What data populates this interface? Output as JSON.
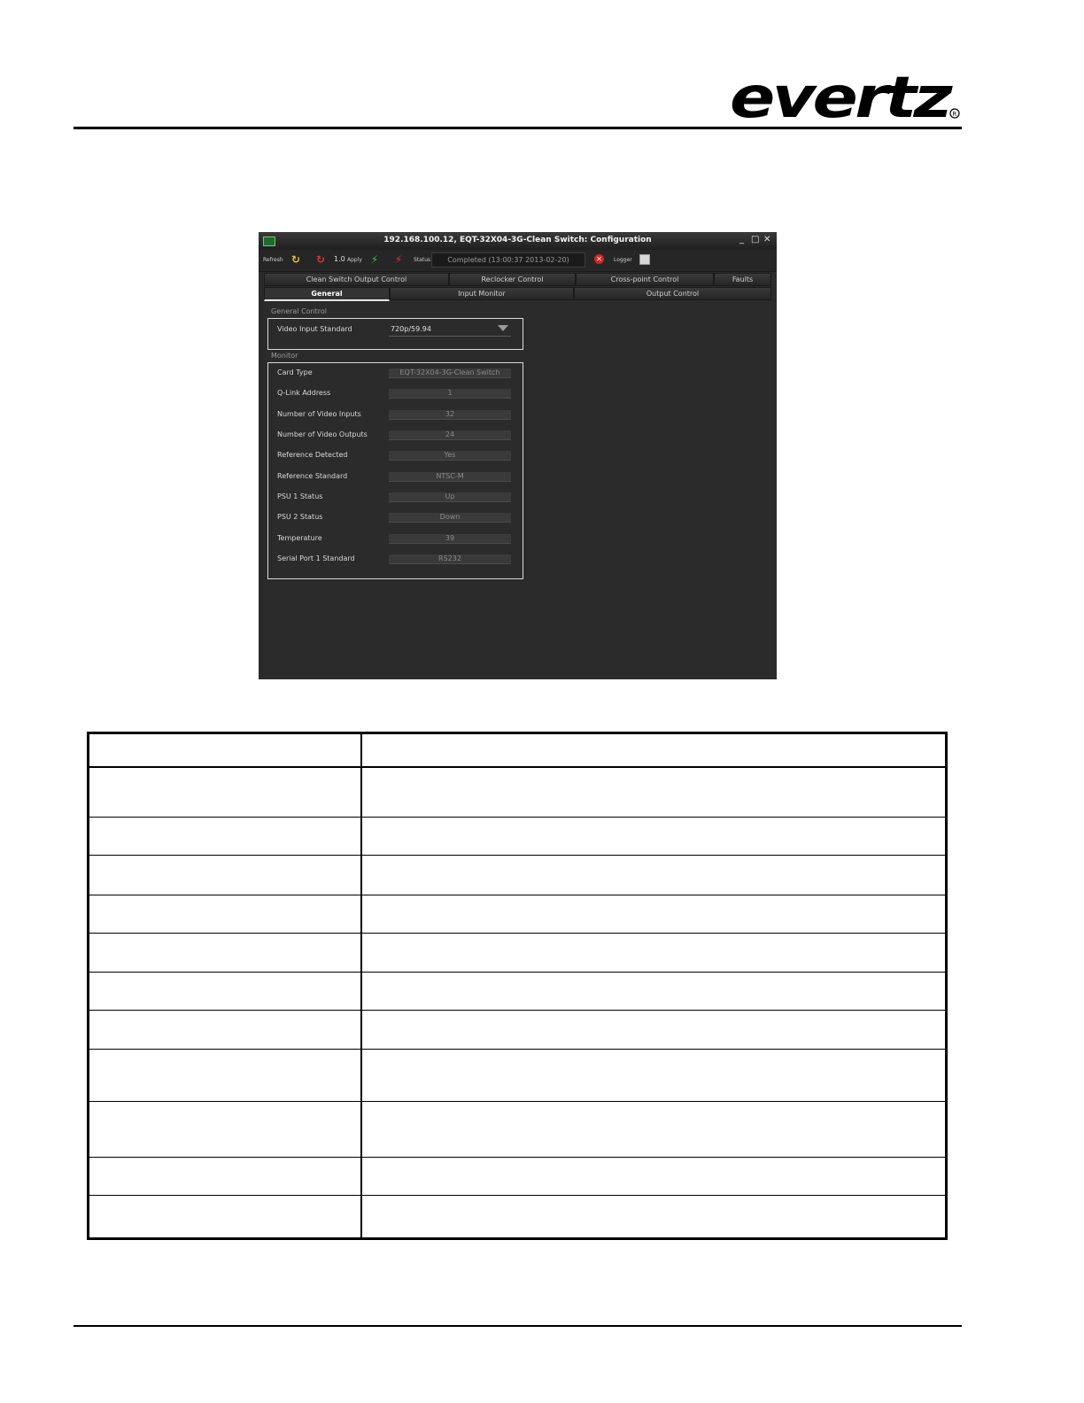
{
  "logo": {
    "text": "evertz"
  },
  "window": {
    "title": "192.168.100.12, EQT-32X04-3G-Clean Switch: Configuration",
    "controls": {
      "minimize": "_",
      "maximize": "□",
      "close": "✕"
    },
    "toolbar": {
      "refresh_label": "Refresh",
      "version": "1.0",
      "apply_label": "Apply",
      "status_label": "Status",
      "status_value": "Completed (13:00:37 2013-02-20)",
      "logger_label": "Logger"
    },
    "tabs_row1": [
      "Clean Switch Output Control",
      "Reclocker Control",
      "Cross-point Control",
      "Faults"
    ],
    "tabs_row2": [
      "General",
      "Input Monitor",
      "Output Control"
    ],
    "active_tab": "General",
    "general_control": {
      "title": "General Control",
      "video_input_standard": {
        "label": "Video Input Standard",
        "value": "720p/59.94"
      }
    },
    "monitor": {
      "title": "Monitor",
      "rows": [
        {
          "label": "Card Type",
          "value": "EQT-32X04-3G-Clean Switch"
        },
        {
          "label": "Q-Link Address",
          "value": "1"
        },
        {
          "label": "Number of Video Inputs",
          "value": "32"
        },
        {
          "label": "Number of Video Outputs",
          "value": "24"
        },
        {
          "label": "Reference Detected",
          "value": "Yes"
        },
        {
          "label": "Reference Standard",
          "value": "NTSC-M"
        },
        {
          "label": "PSU 1 Status",
          "value": "Up"
        },
        {
          "label": "PSU 2 Status",
          "value": "Down"
        },
        {
          "label": "Temperature",
          "value": "39"
        },
        {
          "label": "Serial Port 1 Standard",
          "value": "RS232"
        }
      ]
    }
  },
  "table": {
    "rows": [
      {
        "param": "",
        "desc": ""
      },
      {
        "param": "",
        "desc": ""
      },
      {
        "param": "",
        "desc": ""
      },
      {
        "param": "",
        "desc": ""
      },
      {
        "param": "",
        "desc": ""
      },
      {
        "param": "",
        "desc": ""
      },
      {
        "param": "",
        "desc": ""
      },
      {
        "param": "",
        "desc": ""
      },
      {
        "param": "",
        "desc": ""
      },
      {
        "param": "",
        "desc": ""
      },
      {
        "param": "",
        "desc": ""
      },
      {
        "param": "",
        "desc": ""
      }
    ]
  }
}
